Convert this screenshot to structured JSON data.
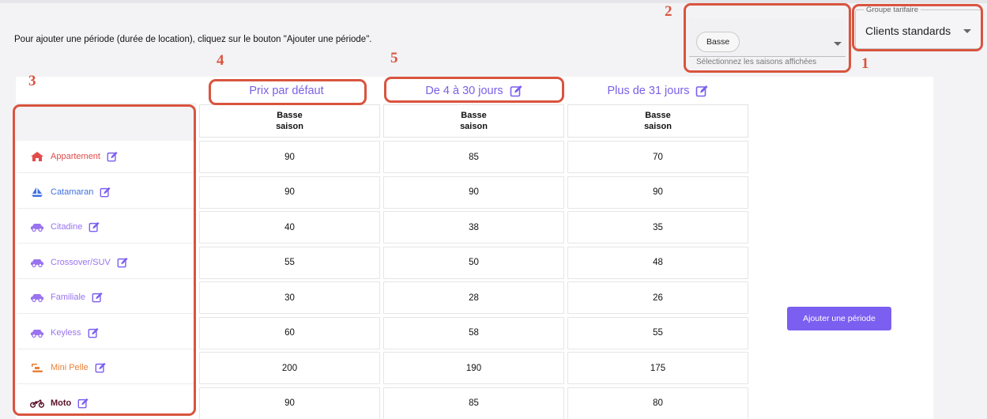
{
  "instructions": "Pour ajouter une période (durée de location), cliquez sur le bouton \"Ajouter une période\".",
  "season_filter": {
    "chip": "Basse",
    "hint": "Sélectionnez les saisons affichées"
  },
  "tarif_group": {
    "legend": "Groupe tarifaire",
    "value": "Clients standards"
  },
  "annotations": [
    "1",
    "2",
    "3",
    "4",
    "5"
  ],
  "columns": [
    {
      "title": "Prix par défaut",
      "sub1": "Basse",
      "sub2": "saison"
    },
    {
      "title": "De 4 à 30 jours",
      "sub1": "Basse",
      "sub2": "saison"
    },
    {
      "title": "Plus de 31 jours",
      "sub1": "Basse",
      "sub2": "saison"
    }
  ],
  "rows": [
    {
      "label": "Appartement",
      "icon": "house-icon",
      "color": "#e24b4b",
      "values": [
        "90",
        "85",
        "70"
      ]
    },
    {
      "label": "Catamaran",
      "icon": "sailboat-icon",
      "color": "#3f6fe0",
      "values": [
        "90",
        "90",
        "90"
      ]
    },
    {
      "label": "Citadine",
      "icon": "car-icon",
      "color": "#9a74f0",
      "values": [
        "40",
        "38",
        "35"
      ]
    },
    {
      "label": "Crossover/SUV",
      "icon": "car-icon",
      "color": "#9a74f0",
      "values": [
        "55",
        "50",
        "48"
      ]
    },
    {
      "label": "Familiale",
      "icon": "car-icon",
      "color": "#9a74f0",
      "values": [
        "30",
        "28",
        "26"
      ]
    },
    {
      "label": "Keyless",
      "icon": "car-icon",
      "color": "#9a74f0",
      "values": [
        "60",
        "58",
        "55"
      ]
    },
    {
      "label": "Mini Pelle",
      "icon": "excavator-icon",
      "color": "#e8813a",
      "values": [
        "200",
        "190",
        "175"
      ]
    },
    {
      "label": "Moto",
      "icon": "motorcycle-icon",
      "color": "#5a1027",
      "values": [
        "90",
        "85",
        "80"
      ]
    }
  ],
  "add_button": "Ajouter une période",
  "colors": {
    "accent": "#7b5ff0",
    "annotation": "#d9543f"
  }
}
